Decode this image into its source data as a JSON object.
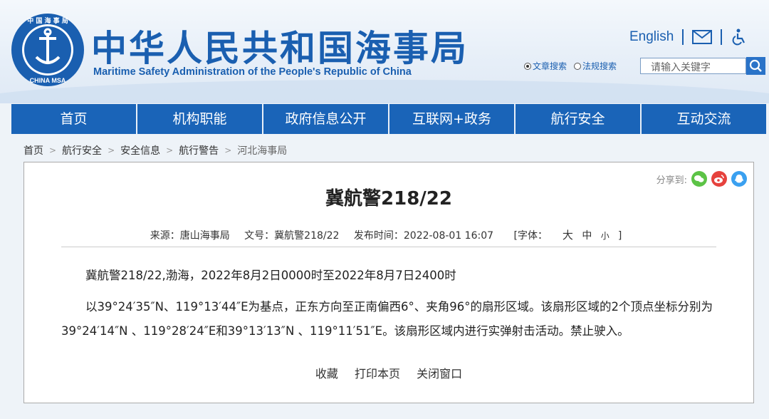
{
  "header": {
    "title_cn": "中华人民共和国海事局",
    "title_en": "Maritime Safety Administration of the People's Republic of China",
    "logo_text_top": "中 国 海 事 局",
    "logo_text_bottom": "CHINA MSA",
    "english_link": "English",
    "search_options": [
      "文章搜索",
      "法规搜索"
    ],
    "search_placeholder": "请输入关键字"
  },
  "nav": [
    "首页",
    "机构职能",
    "政府信息公开",
    "互联网+政务",
    "航行安全",
    "互动交流"
  ],
  "breadcrumb": [
    "首页",
    "航行安全",
    "安全信息",
    "航行警告",
    "河北海事局"
  ],
  "article": {
    "share_label": "分享到:",
    "title": "冀航警218/22",
    "source": "来源：唐山海事局",
    "doc_no": "文号：冀航警218/22",
    "publish_time": "发布时间：2022-08-01 16:07",
    "font_label": "[字体：",
    "font_sizes": [
      "大",
      "中",
      "小"
    ],
    "font_close": "]",
    "paragraphs": [
      "冀航警218/22,渤海，2022年8月2日0000时至2022年8月7日2400时",
      "以39°24′35″N、119°13′44″E为基点，正东方向至正南偏西6°、夹角96°的扇形区域。该扇形区域的2个顶点坐标分别为39°24′14″N 、119°28′24″E和39°13′13″N 、119°11′51″E。该扇形区域内进行实弹射击活动。禁止驶入。"
    ],
    "actions": [
      "收藏",
      "打印本页",
      "关闭窗口"
    ]
  },
  "colors": {
    "brand_blue": "#1a64b8",
    "wechat": "#5cc346",
    "weibo": "#e6423d",
    "qq": "#3aa0f0"
  }
}
